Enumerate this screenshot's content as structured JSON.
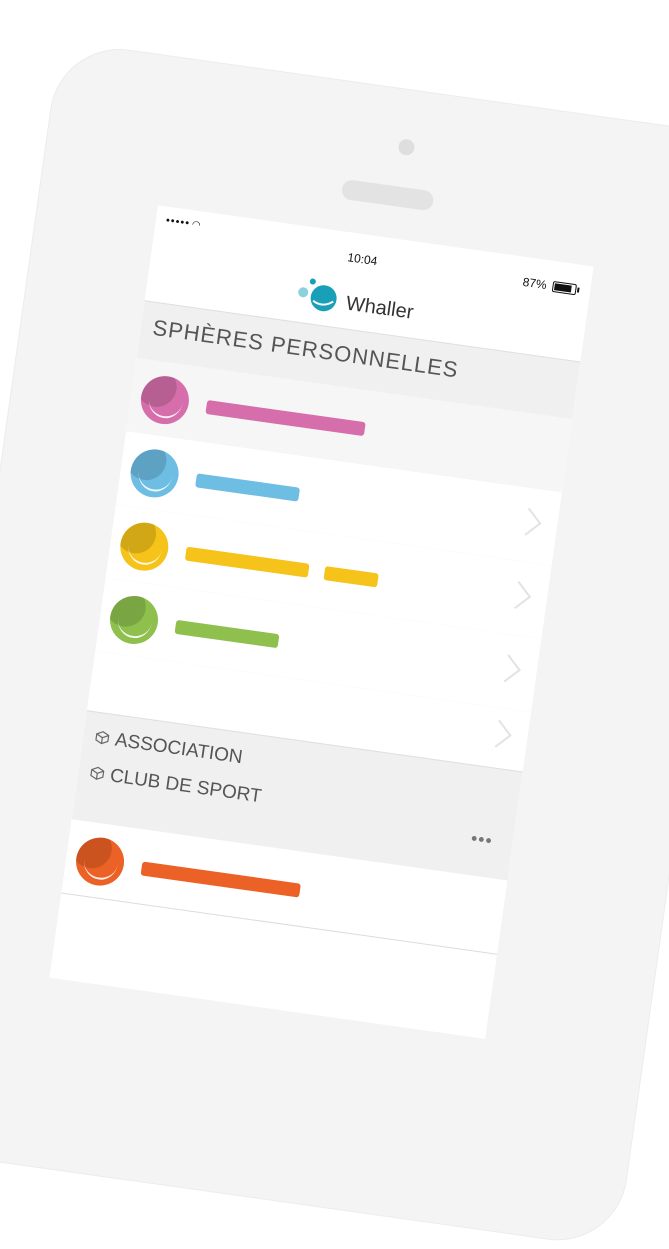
{
  "status_bar": {
    "signal": "•••••",
    "time": "10:04",
    "battery": "87%"
  },
  "app": {
    "title": "Whaller"
  },
  "sections": {
    "personal_title": "SPHÈRES PERSONNELLES",
    "organizations": [
      {
        "label": "ASSOCIATION"
      },
      {
        "label": "CLUB DE SPORT"
      }
    ]
  },
  "colors": {
    "pink": "#d66eab",
    "blue": "#6ebde3",
    "yellow": "#f5c31a",
    "green": "#8fc04e",
    "orange": "#ec6126",
    "logo_teal": "#1a9fb8"
  },
  "icons": {
    "wifi": "wifi-icon",
    "chevron": "chevron-right-icon",
    "cube": "cube-icon",
    "more": "more-horizontal-icon"
  },
  "more_label": "•••"
}
